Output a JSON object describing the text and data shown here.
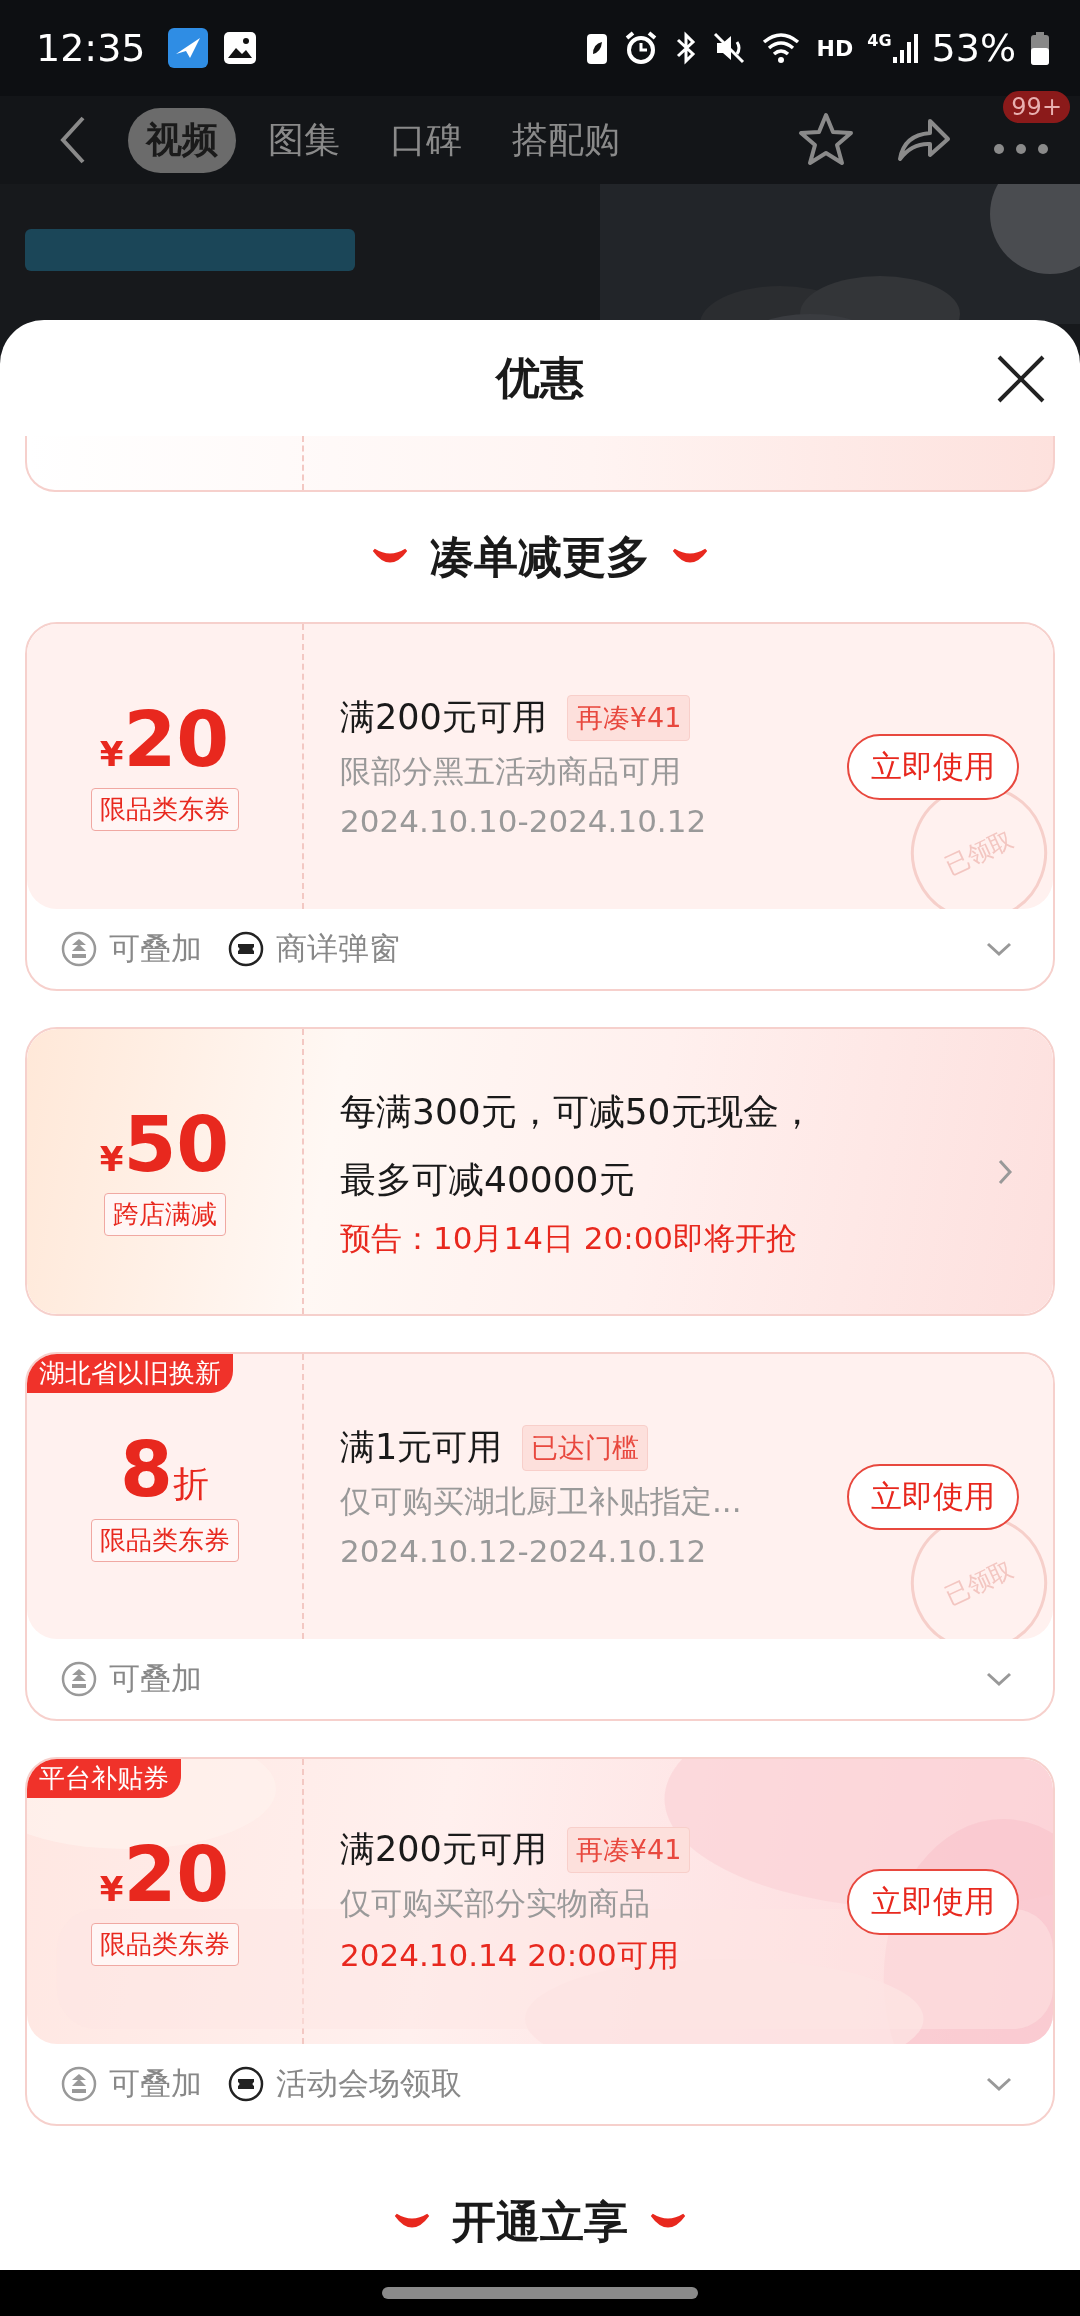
{
  "status_bar": {
    "time": "12:35",
    "network_label": "HD",
    "cell_label": "4G",
    "battery": "53%"
  },
  "nav": {
    "tabs": [
      {
        "label": "视频",
        "selected": true
      },
      {
        "label": "图集",
        "selected": false
      },
      {
        "label": "口碑",
        "selected": false
      },
      {
        "label": "搭配购",
        "selected": false
      }
    ],
    "badge": "99+"
  },
  "sheet": {
    "title": "优惠",
    "section_title": "凑单减更多",
    "coupons": [
      {
        "kind": "claimed",
        "amount": {
          "prefix": "¥",
          "value": "20"
        },
        "type_tag": "限品类东券",
        "title": "满200元可用",
        "chip": "再凑¥41",
        "lines": [
          "限部分黑五活动商品可用"
        ],
        "date": "2024.10.10-2024.10.12",
        "date_highlight": false,
        "button": "立即使用",
        "stamp": "已领取",
        "features": [
          {
            "kind": "stack",
            "label": "可叠加"
          },
          {
            "kind": "popup",
            "label": "商详弹窗"
          }
        ]
      },
      {
        "kind": "promo",
        "amount": {
          "prefix": "¥",
          "value": "50"
        },
        "type_tag": "跨店满减",
        "lines": [
          "每满300元，可减50元现金，",
          "最多可减40000元"
        ],
        "date": "预告：10月14日 20:00即将开抢",
        "date_highlight": true
      },
      {
        "kind": "claimed",
        "corner_tag": "湖北省以旧换新",
        "amount": {
          "value": "8",
          "suffix": "折"
        },
        "type_tag": "限品类东券",
        "title": "满1元可用",
        "chip": "已达门槛",
        "lines": [
          "仅可购买湖北厨卫补贴指定..."
        ],
        "date": "2024.10.12-2024.10.12",
        "date_highlight": false,
        "button": "立即使用",
        "stamp": "已领取",
        "features": [
          {
            "kind": "stack",
            "label": "可叠加"
          }
        ]
      },
      {
        "kind": "claimed",
        "corner_tag": "平台补贴券",
        "fancy": true,
        "amount": {
          "prefix": "¥",
          "value": "20"
        },
        "type_tag": "限品类东券",
        "title": "满200元可用",
        "chip": "再凑¥41",
        "lines": [
          "仅可购买部分实物商品"
        ],
        "date": "2024.10.14 20:00可用",
        "date_highlight": true,
        "button": "立即使用",
        "features": [
          {
            "kind": "stack",
            "label": "可叠加"
          },
          {
            "kind": "popup",
            "label": "活动会场领取"
          }
        ]
      }
    ],
    "next_section_title": "开通立享"
  }
}
